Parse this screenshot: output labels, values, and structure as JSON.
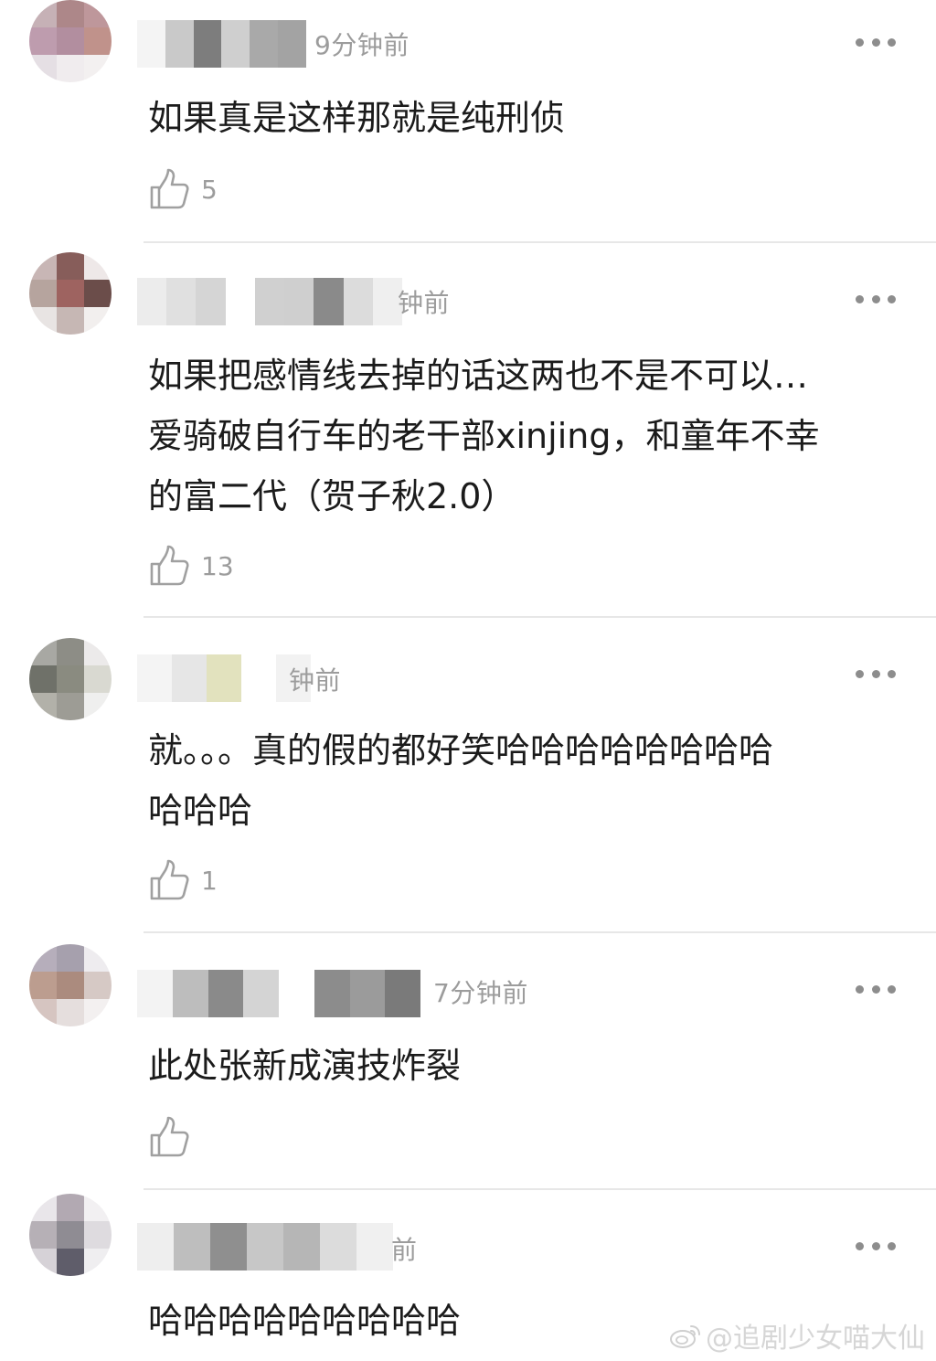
{
  "comments": [
    {
      "time": "9分钟前",
      "text": "如果真是这样那就是纯刑侦",
      "likes": "5",
      "avatar_colors": [
        "#c9b0b6",
        "#b28688",
        "#c3969a",
        "#c29bb0",
        "#b78ca0",
        "#c69088",
        "#e6dfe4",
        "#f1ecee",
        "#f3f0f0"
      ],
      "name_colors": [
        "#f4f4f4",
        "#c9c9c9",
        "#7d7d7d",
        "#cfcfcf",
        "#a9a9a9",
        "#a3a3a3"
      ]
    },
    {
      "time": "钟前",
      "text": "如果把感情线去掉的话这两也不是不可以…\n爱骑破自行车的老干部xinjing，和童年不幸\n的富二代（贺子秋2.0）",
      "likes": "13",
      "avatar_colors": [
        "#cbb5b4",
        "#8d5b58",
        "#efe8e8",
        "#b9a39c",
        "#a6615d",
        "#6f4c48",
        "#e9e4e3",
        "#c8b7b3",
        "#f2efee"
      ],
      "name_colors": [
        "#ececec",
        "#e0e0e0",
        "#d5d5d5",
        "#ffffff",
        "#d0d0d0",
        "#cfcfcf",
        "#8a8a8a",
        "#dcdcdc",
        "#efefef"
      ]
    },
    {
      "time": "钟前",
      "text": "就。。。真的假的都好笑哈哈哈哈哈哈哈哈\n哈哈哈",
      "likes": "1",
      "avatar_colors": [
        "#a8a8a2",
        "#8d8d85",
        "#eceaea",
        "#6f7168",
        "#8a8b7e",
        "#d9d9d0",
        "#b2b1a8",
        "#9d9c94",
        "#efefee"
      ],
      "name_colors": [
        "#f4f4f4",
        "#e6e6e6",
        "#e2e2be",
        "#ffffff",
        "#f2f2f2"
      ]
    },
    {
      "time": "7分钟前",
      "text": "此处张新成演技炸裂",
      "likes": "",
      "avatar_colors": [
        "#b7aebd",
        "#a7a0af",
        "#eeecef",
        "#c19c8c",
        "#b08a7b",
        "#d8c9c4",
        "#d8c4c0",
        "#e6dedd",
        "#f3f0f0"
      ],
      "name_colors": [
        "#f3f3f3",
        "#bdbdbd",
        "#8a8a8a",
        "#d4d4d4",
        "#ffffff",
        "#8c8c8c",
        "#9b9b9b",
        "#7a7a7a"
      ]
    },
    {
      "time": "前",
      "text": "哈哈哈哈哈哈哈哈哈",
      "likes": "",
      "avatar_colors": [
        "#e9e6ea",
        "#b3a9b3",
        "#f2f0f2",
        "#b7b0b7",
        "#8f8c94",
        "#dedbe0",
        "#d6d2d8",
        "#5f5d6c",
        "#efeef0"
      ],
      "name_colors": [
        "#eeeeee",
        "#bebebe",
        "#8f8f8f",
        "#c7c7c7",
        "#b6b6b6",
        "#dcdcdc",
        "#f0f0f0"
      ]
    }
  ],
  "watermark": {
    "text": "@追剧少女喵大仙",
    "icon": "weibo-icon"
  },
  "colors": {
    "timestamp": "#9c9c9c",
    "body_text": "#1b1b1b",
    "divider": "#e7e7e7",
    "icon_gray": "#a0a0a0"
  }
}
